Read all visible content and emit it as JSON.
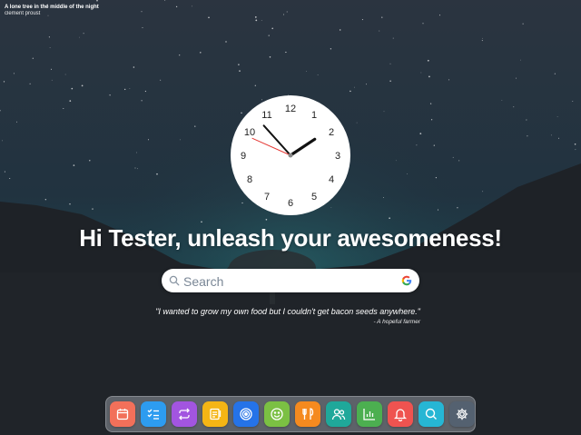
{
  "photo": {
    "title": "A lone tree in the middle of the night",
    "author": "clement proust"
  },
  "clock": {
    "numbers": [
      "12",
      "1",
      "2",
      "3",
      "4",
      "5",
      "6",
      "7",
      "8",
      "9",
      "10",
      "11"
    ],
    "time": {
      "hour": 1,
      "minute": 53,
      "second": 49
    },
    "colors": {
      "face": "#ffffff",
      "hands": "#111111",
      "second_hand": "#e53935"
    }
  },
  "greeting": "Hi Tester, unleash your awesomeness!",
  "search": {
    "placeholder": "Search",
    "value": ""
  },
  "quote": {
    "text": "\"I wanted to grow my own food but I couldn't get bacon seeds anywhere.\"",
    "author": "- A hopeful farmer"
  },
  "dock": {
    "apps": [
      {
        "name": "calendar-icon",
        "color": "#f2705a"
      },
      {
        "name": "checklist-icon",
        "color": "#2d9cf0"
      },
      {
        "name": "repeat-icon",
        "color": "#a255e0"
      },
      {
        "name": "notes-icon",
        "color": "#f5b515"
      },
      {
        "name": "target-icon",
        "color": "#2573e8"
      },
      {
        "name": "smiley-icon",
        "color": "#7bc043"
      },
      {
        "name": "food-icon",
        "color": "#f58a1f"
      },
      {
        "name": "people-icon",
        "color": "#1fa89a"
      },
      {
        "name": "chart-icon",
        "color": "#4caf50"
      },
      {
        "name": "bell-icon",
        "color": "#ef5350"
      },
      {
        "name": "search-icon",
        "color": "#26b6d4"
      },
      {
        "name": "settings-icon",
        "color": "#546170"
      }
    ]
  }
}
